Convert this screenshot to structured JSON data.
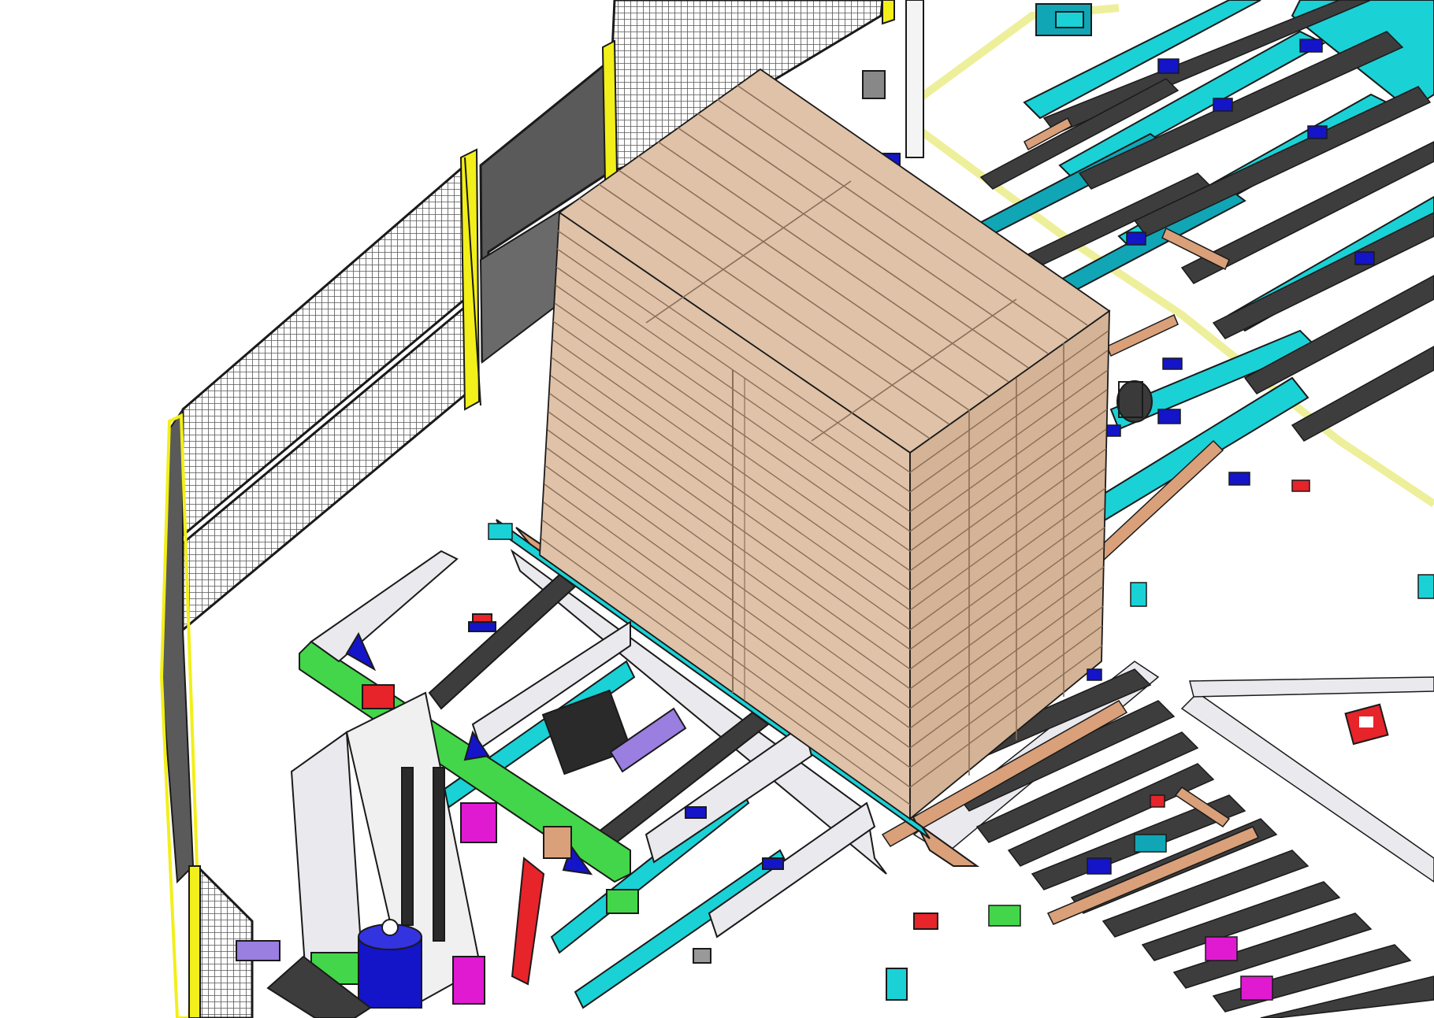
{
  "scene": {
    "subject": "cad-render",
    "colors": {
      "background": "#ffffff",
      "outline": "#1a1a1a",
      "fence_mesh": "#555555",
      "fence_post": "#f2ef1a",
      "door_panel": "#5a5a5a",
      "pallet_wood": "#dfc2a8",
      "pallet_dark": "#b99a80",
      "conveyor_cyan": "#1ad1d6",
      "conveyor_teal": "#10a6b6",
      "roller_dark": "#3d3d3d",
      "frame_light": "#e9e9ee",
      "frame_tan": "#d9a07a",
      "pale_yellow": "#eeef9a",
      "blue_part": "#1414c8",
      "green_part": "#43d64a",
      "magenta_part": "#e01ad1",
      "red_part": "#e6242a",
      "purple_part": "#9a7ee0"
    }
  }
}
